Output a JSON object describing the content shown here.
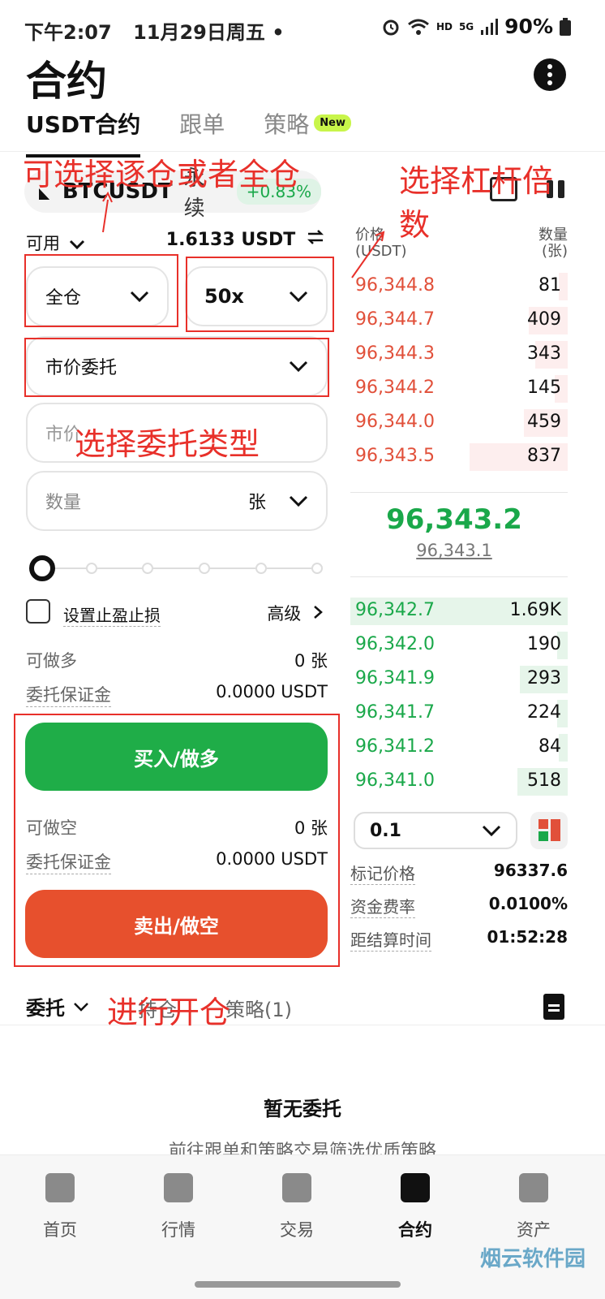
{
  "status": {
    "time": "下午2:07",
    "date": "11月29日周五",
    "dot": "•",
    "net_hd": "HD",
    "net_5g": "5G",
    "battery": "90%"
  },
  "header": {
    "title": "合约",
    "tabs": [
      {
        "label": "USDT合约"
      },
      {
        "label": "跟单"
      },
      {
        "label": "策略"
      }
    ],
    "new_badge": "New"
  },
  "pair": {
    "symbol": "BTCUSDT",
    "type": "永续",
    "change": "+0.83%"
  },
  "account": {
    "available_label": "可用",
    "available_value": "1.6133 USDT"
  },
  "form": {
    "margin_mode": "全仓",
    "leverage": "50x",
    "order_type": "市价委托",
    "price_placeholder": "市价",
    "qty_placeholder": "数量",
    "qty_unit": "张",
    "slider_value": 0,
    "tp_sl_label": "设置止盈止损",
    "advanced_label": "高级"
  },
  "long": {
    "max_label": "可做多",
    "max_value": "0 张",
    "margin_label": "委托保证金",
    "margin_value": "0.0000 USDT",
    "button": "买入/做多"
  },
  "short": {
    "max_label": "可做空",
    "max_value": "0 张",
    "margin_label": "委托保证金",
    "margin_value": "0.0000 USDT",
    "button": "卖出/做空"
  },
  "orderbook": {
    "price_header": "价格\n(USDT)",
    "qty_header": "数量\n(张)",
    "asks": [
      {
        "price": "96,344.8",
        "qty": "81",
        "depth": 0.04
      },
      {
        "price": "96,344.7",
        "qty": "409",
        "depth": 0.18
      },
      {
        "price": "96,344.3",
        "qty": "343",
        "depth": 0.15
      },
      {
        "price": "96,344.2",
        "qty": "145",
        "depth": 0.06
      },
      {
        "price": "96,344.0",
        "qty": "459",
        "depth": 0.2
      },
      {
        "price": "96,343.5",
        "qty": "837",
        "depth": 0.45
      }
    ],
    "last_price": "96,343.2",
    "mark_price": "96,343.1",
    "bids": [
      {
        "price": "96,342.7",
        "qty": "1.69K",
        "depth": 1.0
      },
      {
        "price": "96,342.0",
        "qty": "190",
        "depth": 0.05
      },
      {
        "price": "96,341.9",
        "qty": "293",
        "depth": 0.22
      },
      {
        "price": "96,341.7",
        "qty": "224",
        "depth": 0.05
      },
      {
        "price": "96,341.2",
        "qty": "84",
        "depth": 0.04
      },
      {
        "price": "96,341.0",
        "qty": "518",
        "depth": 0.23
      }
    ],
    "precision": "0.1"
  },
  "stats": [
    {
      "label": "标记价格",
      "value": "96337.6"
    },
    {
      "label": "资金费率",
      "value": "0.0100%"
    },
    {
      "label": "距结算时间",
      "value": "01:52:28"
    }
  ],
  "orders": {
    "tabs": [
      {
        "label": "委托"
      },
      {
        "label": "持仓"
      },
      {
        "label": "策略(1)"
      }
    ],
    "empty_title": "暂无委托",
    "empty_sub": "前往跟单和策略交易筛选优质策略"
  },
  "nav": [
    {
      "label": "首页"
    },
    {
      "label": "行情"
    },
    {
      "label": "交易"
    },
    {
      "label": "合约"
    },
    {
      "label": "资产"
    }
  ],
  "annotations": {
    "margin": "可选择逐仓或者全仓",
    "leverage_l1": "选择杠杆倍",
    "leverage_l2": "数",
    "order_type": "选择委托类型",
    "open": "进行开仓"
  },
  "watermark": "烟云软件园",
  "colors": {
    "buy": "#1fad48",
    "sell": "#e7502d",
    "annotation": "#e8302a"
  }
}
